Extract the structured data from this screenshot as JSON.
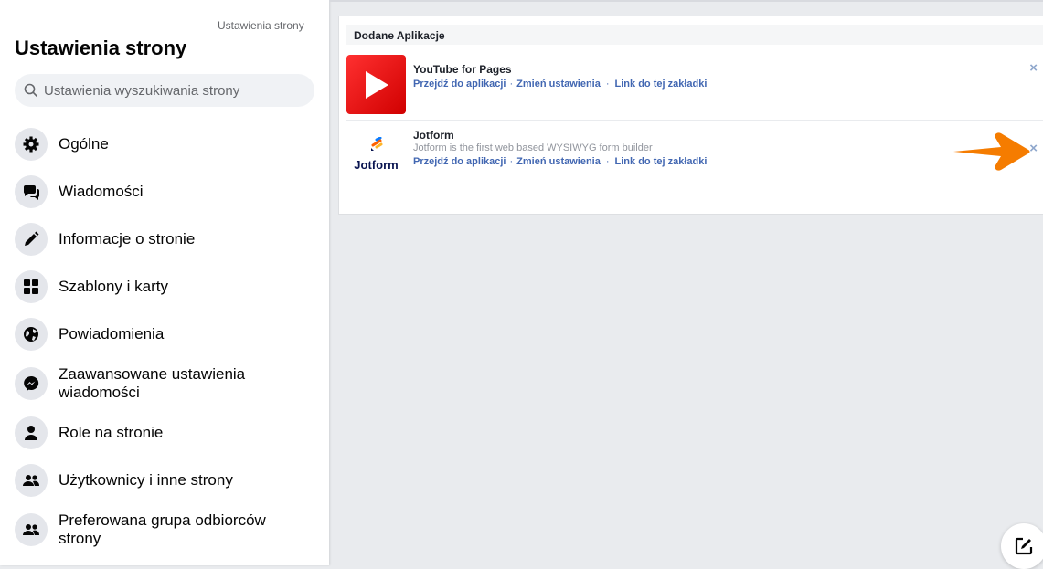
{
  "sidebar": {
    "breadcrumb": "Ustawienia strony",
    "title": "Ustawienia strony",
    "search_placeholder": "Ustawienia wyszukiwania strony",
    "items": [
      {
        "label": "Ogólne",
        "icon": "gear-icon"
      },
      {
        "label": "Wiadomości",
        "icon": "chat-bubbles-icon"
      },
      {
        "label": "Informacje o stronie",
        "icon": "pencil-icon"
      },
      {
        "label": "Szablony i karty",
        "icon": "grid-icon"
      },
      {
        "label": "Powiadomienia",
        "icon": "globe-icon"
      },
      {
        "label": "Zaawansowane ustawienia wiadomości",
        "icon": "messenger-icon"
      },
      {
        "label": "Role na stronie",
        "icon": "person-icon"
      },
      {
        "label": "Użytkownicy i inne strony",
        "icon": "people-icon"
      },
      {
        "label": "Preferowana grupa odbiorców strony",
        "icon": "people-icon"
      }
    ]
  },
  "main": {
    "section_title": "Dodane Aplikacje",
    "apps": [
      {
        "name": "YouTube for Pages",
        "description": "",
        "links": [
          "Przejdź do aplikacji",
          "Zmień ustawienia",
          "Link do tej zakładki"
        ]
      },
      {
        "name": "Jotform",
        "logo_text": "Jotform",
        "description": "Jotform is the first web based WYSIWYG form builder",
        "links": [
          "Przejdź do aplikacji",
          "Zmień ustawienia",
          "Link do tej zakładki"
        ]
      }
    ],
    "close_symbol": "×",
    "link_separator": "·"
  },
  "colors": {
    "link": "#4267b2",
    "arrow": "#f57c00",
    "youtube": "#e60000"
  }
}
